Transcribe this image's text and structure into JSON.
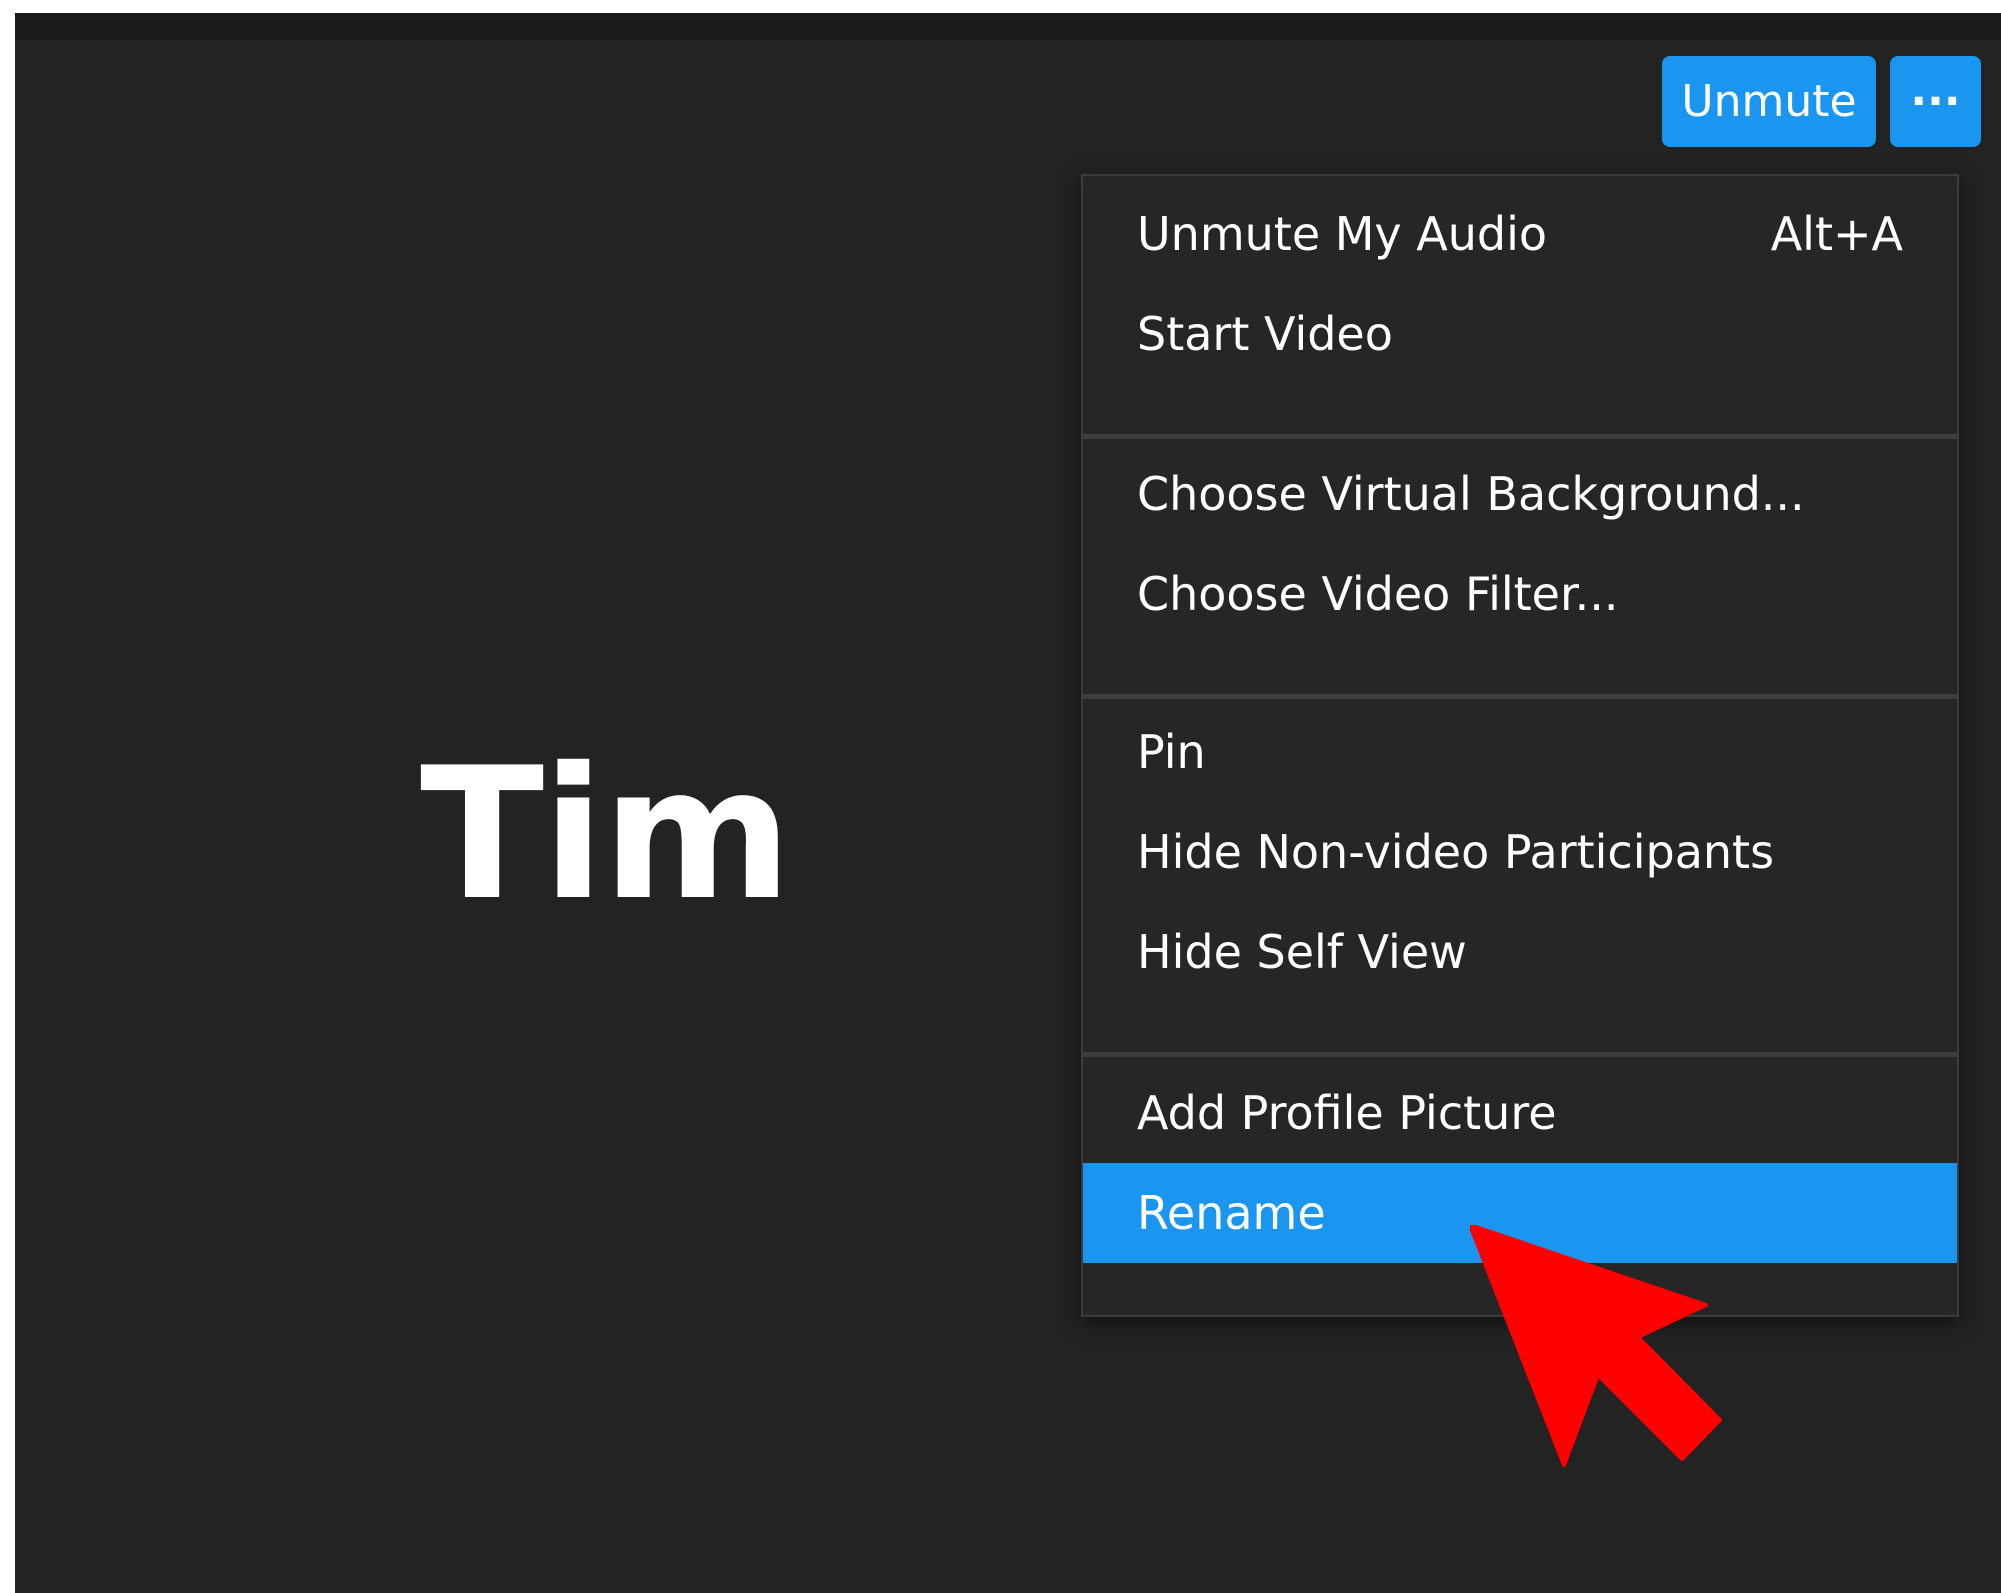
{
  "participant": {
    "name": "Tim"
  },
  "controls": {
    "unmute_label": "Unmute",
    "more_label": "···"
  },
  "menu": {
    "groups": [
      [
        {
          "label": "Unmute My Audio",
          "shortcut": "Alt+A"
        },
        {
          "label": "Start Video",
          "shortcut": ""
        }
      ],
      [
        {
          "label": "Choose Virtual Background...",
          "shortcut": ""
        },
        {
          "label": "Choose Video Filter...",
          "shortcut": ""
        }
      ],
      [
        {
          "label": "Pin",
          "shortcut": ""
        },
        {
          "label": "Hide Non-video Participants",
          "shortcut": ""
        },
        {
          "label": "Hide Self View",
          "shortcut": ""
        }
      ],
      [
        {
          "label": "Add Profile Picture",
          "shortcut": ""
        },
        {
          "label": "Rename",
          "shortcut": "",
          "highlighted": true
        }
      ]
    ]
  },
  "colors": {
    "background": "#232323",
    "accent": "#1a96f0",
    "menu_bg": "#262626",
    "pointer": "#ff0000"
  },
  "annotations": {
    "pointer_icon": "red-arrow-cursor-icon"
  }
}
